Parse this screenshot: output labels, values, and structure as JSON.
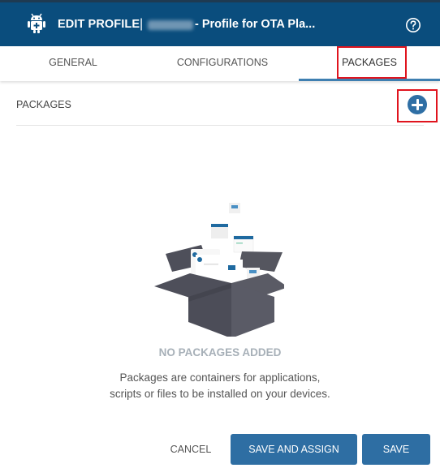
{
  "header": {
    "icon": "android-icon",
    "title": "EDIT PROFILE",
    "separator": "|",
    "subtitle": "- Profile for OTA Pla...",
    "help_icon": "help-circle-icon"
  },
  "tabs": [
    {
      "label": "GENERAL",
      "active": false
    },
    {
      "label": "CONFIGURATIONS",
      "active": false
    },
    {
      "label": "PACKAGES",
      "active": true
    }
  ],
  "section": {
    "title": "PACKAGES",
    "add_icon": "plus-circle-icon"
  },
  "empty_state": {
    "title": "NO PACKAGES ADDED",
    "description_line1": "Packages are containers for applications,",
    "description_line2": "scripts or files to be installed on your devices."
  },
  "footer": {
    "cancel_label": "CANCEL",
    "save_assign_label": "SAVE AND ASSIGN",
    "save_label": "SAVE"
  },
  "colors": {
    "header_bg": "#0a4d7d",
    "accent": "#2e6ea3",
    "tab_underline": "#3e7fb1",
    "highlight_box": "#e0141e"
  }
}
